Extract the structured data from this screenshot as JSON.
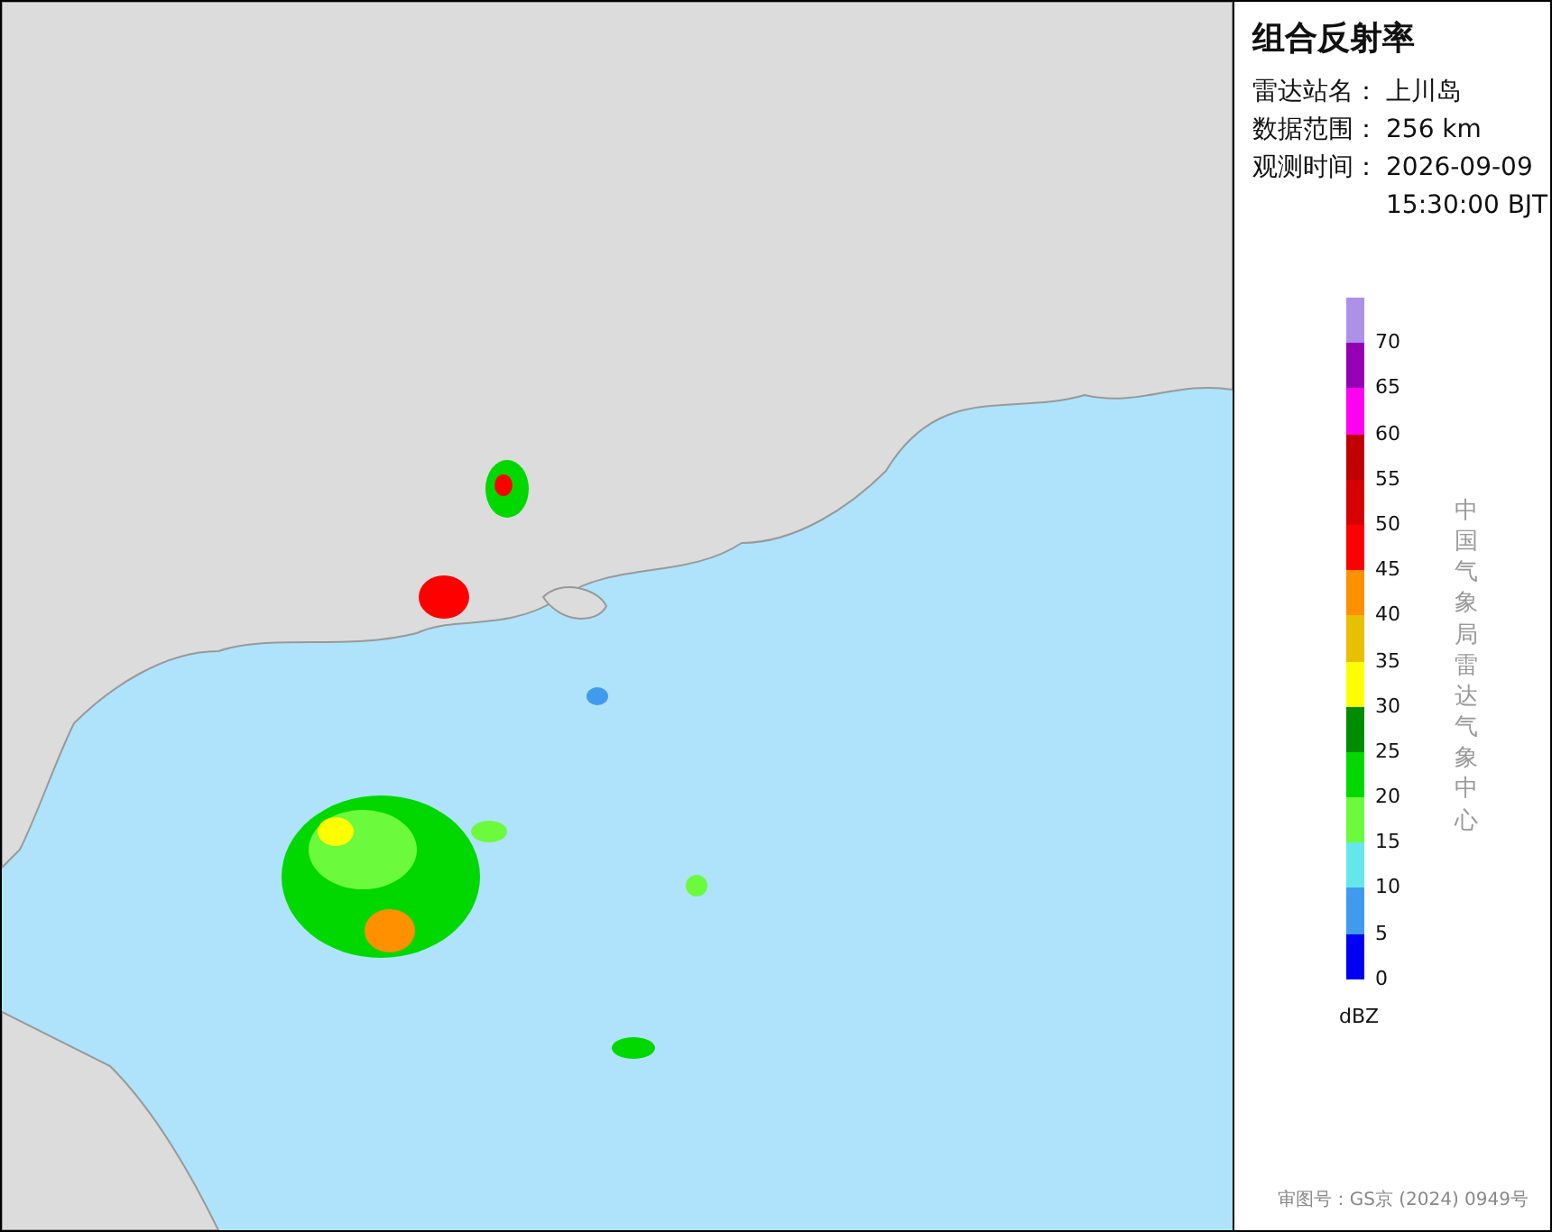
{
  "title": "组合反射率",
  "info": [
    {
      "label": "雷达站名：",
      "value": "上川岛"
    },
    {
      "label": "数据范围：",
      "value": "256 km"
    },
    {
      "label": "观测时间：",
      "value": "2026-09-09\n15:30:00 BJT"
    }
  ],
  "legend": {
    "unit": "dBZ",
    "items": [
      {
        "label": "70",
        "color": "#ad91e9"
      },
      {
        "label": "65",
        "color": "#9400b4"
      },
      {
        "label": "60",
        "color": "#ff00f0"
      },
      {
        "label": "55",
        "color": "#c00000"
      },
      {
        "label": "50",
        "color": "#d60000"
      },
      {
        "label": "45",
        "color": "#ff0000"
      },
      {
        "label": "40",
        "color": "#ff9000"
      },
      {
        "label": "35",
        "color": "#e7c000"
      },
      {
        "label": "30",
        "color": "#ffff00"
      },
      {
        "label": "25",
        "color": "#008c00"
      },
      {
        "label": "20",
        "color": "#00d800"
      },
      {
        "label": "15",
        "color": "#6cfa3d"
      },
      {
        "label": "10",
        "color": "#64e7eb"
      },
      {
        "label": "5",
        "color": "#409aee"
      },
      {
        "label": "0",
        "color": "#0000f6"
      }
    ]
  },
  "credit": "中国气象局雷达气象中心",
  "approval": "审图号：GS京 (2024) 0949号"
}
